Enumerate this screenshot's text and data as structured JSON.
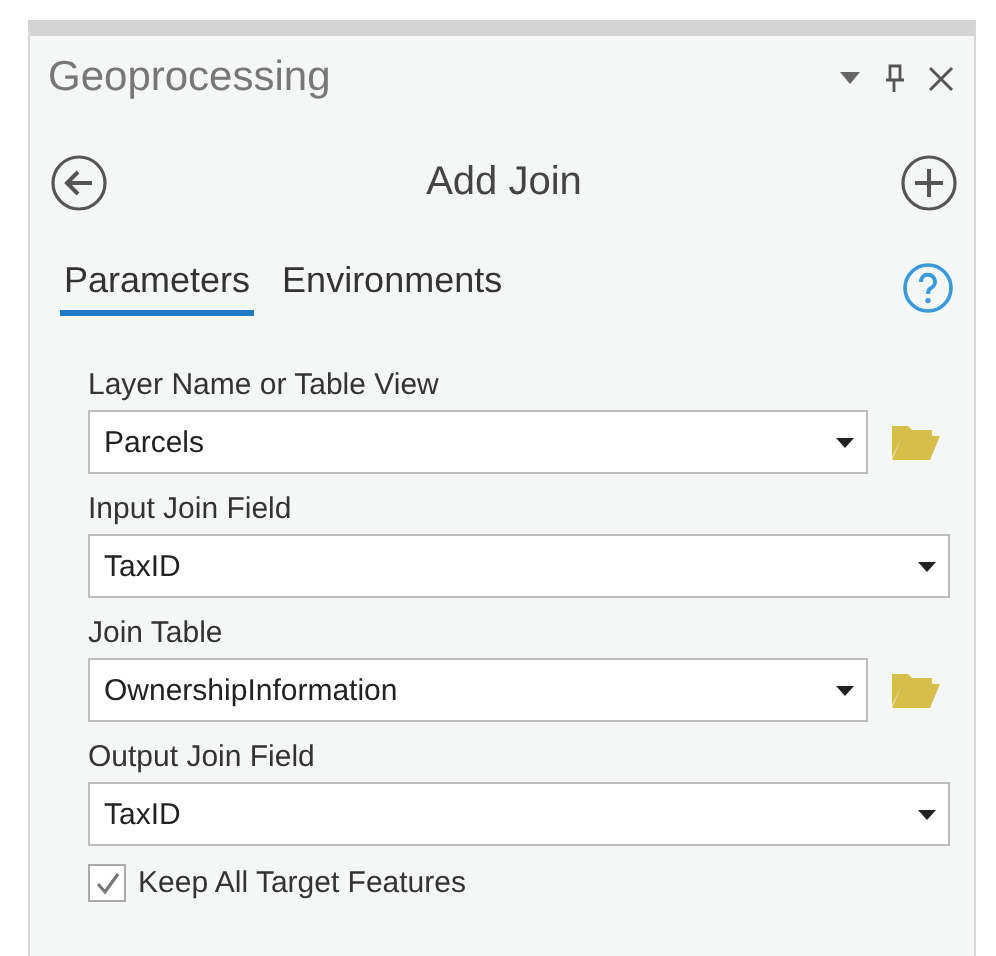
{
  "pane": {
    "title": "Geoprocessing"
  },
  "tool": {
    "title": "Add Join"
  },
  "tabs": [
    {
      "label": "Parameters",
      "selected": true
    },
    {
      "label": "Environments",
      "selected": false
    }
  ],
  "parameters": [
    {
      "kind": "dropdown",
      "label": "Layer Name or Table View",
      "value": "Parcels",
      "browse": true
    },
    {
      "kind": "dropdown",
      "label": "Input Join Field",
      "value": "TaxID",
      "browse": false
    },
    {
      "kind": "dropdown",
      "label": "Join Table",
      "value": "OwnershipInformation",
      "browse": true
    },
    {
      "kind": "dropdown",
      "label": "Output Join Field",
      "value": "TaxID",
      "browse": false
    },
    {
      "kind": "checkbox",
      "label": "Keep All Target Features",
      "checked": true
    }
  ]
}
